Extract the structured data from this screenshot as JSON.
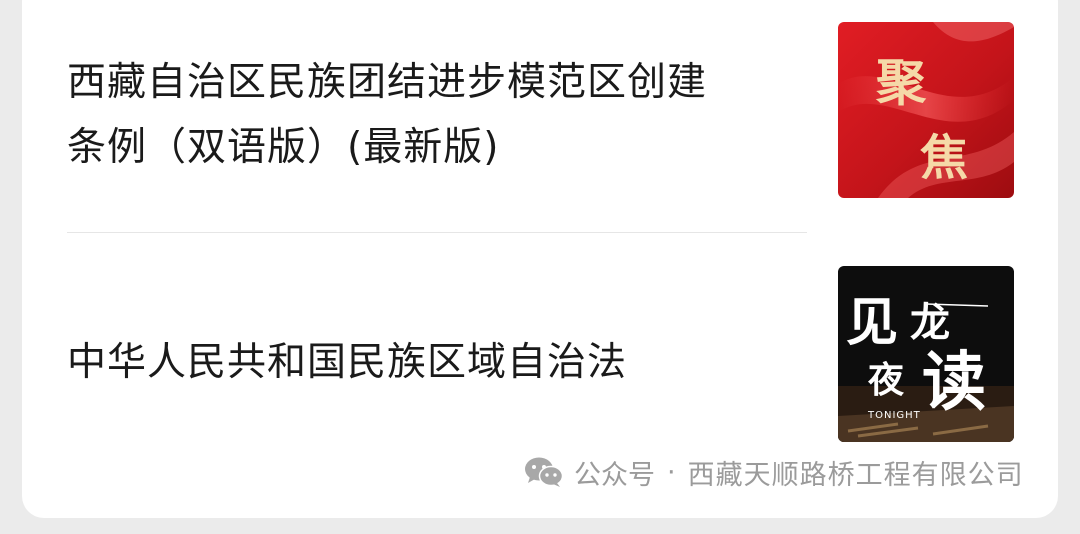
{
  "articles": [
    {
      "title_line1": "西藏自治区民族团结进步模范区创建",
      "title_line2": "条例（双语版）(最新版)",
      "thumbnail": {
        "icon": "red-banner-thumbnail",
        "text_top": "聚",
        "text_bottom": "焦",
        "colors": {
          "bg": "#d0161b",
          "text": "#f5d9a8"
        }
      }
    },
    {
      "title": "中华人民共和国民族区域自治法",
      "thumbnail": {
        "icon": "night-reading-thumbnail",
        "text_a": "见",
        "text_b": "龙",
        "text_c": "夜",
        "text_d": "读",
        "text_tonight": "TONIGHT",
        "colors": {
          "bg": "#0d0d0d",
          "text": "#ffffff"
        }
      }
    }
  ],
  "footer": {
    "icon": "wechat-icon",
    "label": "公众号",
    "separator": "·",
    "account_name": "西藏天顺路桥工程有限公司"
  }
}
